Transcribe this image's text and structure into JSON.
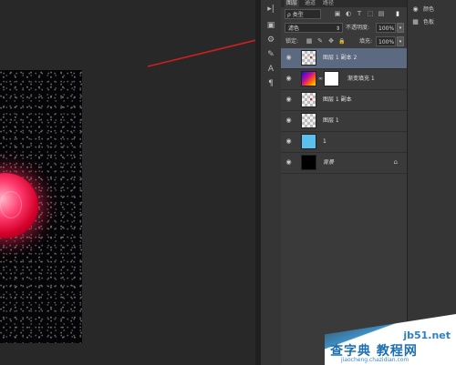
{
  "mini_toolbar": {
    "items": [
      "▸|",
      "▣",
      "⚙",
      "✎",
      "A",
      "¶"
    ]
  },
  "layers_panel": {
    "tabs": [
      "图层",
      "通道",
      "路径"
    ],
    "filter": {
      "kind_label": "ρ 类型",
      "icons": [
        "▣",
        "◐",
        "T",
        "⬚",
        "▤"
      ]
    },
    "blend_mode": "滤色",
    "opacity_label": "不透明度:",
    "opacity_value": "100%",
    "lock_label": "锁定:",
    "lock_icons": [
      "▦",
      "✎",
      "✥",
      "🔒"
    ],
    "fill_label": "填充:",
    "fill_value": "100%",
    "layers": [
      {
        "name": "图层 1 副本 2",
        "thumb": "transparent",
        "selected": true
      },
      {
        "name": "渐变填充 1",
        "thumb": "gradient",
        "mask": true
      },
      {
        "name": "图层 1 副本",
        "thumb": "transparent"
      },
      {
        "name": "图层 1",
        "thumb": "transparent"
      },
      {
        "name": "1",
        "thumb": "blue"
      },
      {
        "name": "背景",
        "thumb": "black",
        "italic": true,
        "locked": true
      }
    ]
  },
  "right_dock": {
    "items": [
      {
        "icon": "◉",
        "label": "颜色"
      },
      {
        "icon": "▦",
        "label": "色板"
      }
    ]
  },
  "watermark": {
    "site": "jb51.net",
    "title": "查字典 教程网",
    "url": "jiaocheng.chazidian.com"
  },
  "colors": {
    "arrow": "#cc1f1f",
    "selected_layer": "#5b6a80",
    "panel_bg": "#3a3a3a"
  }
}
